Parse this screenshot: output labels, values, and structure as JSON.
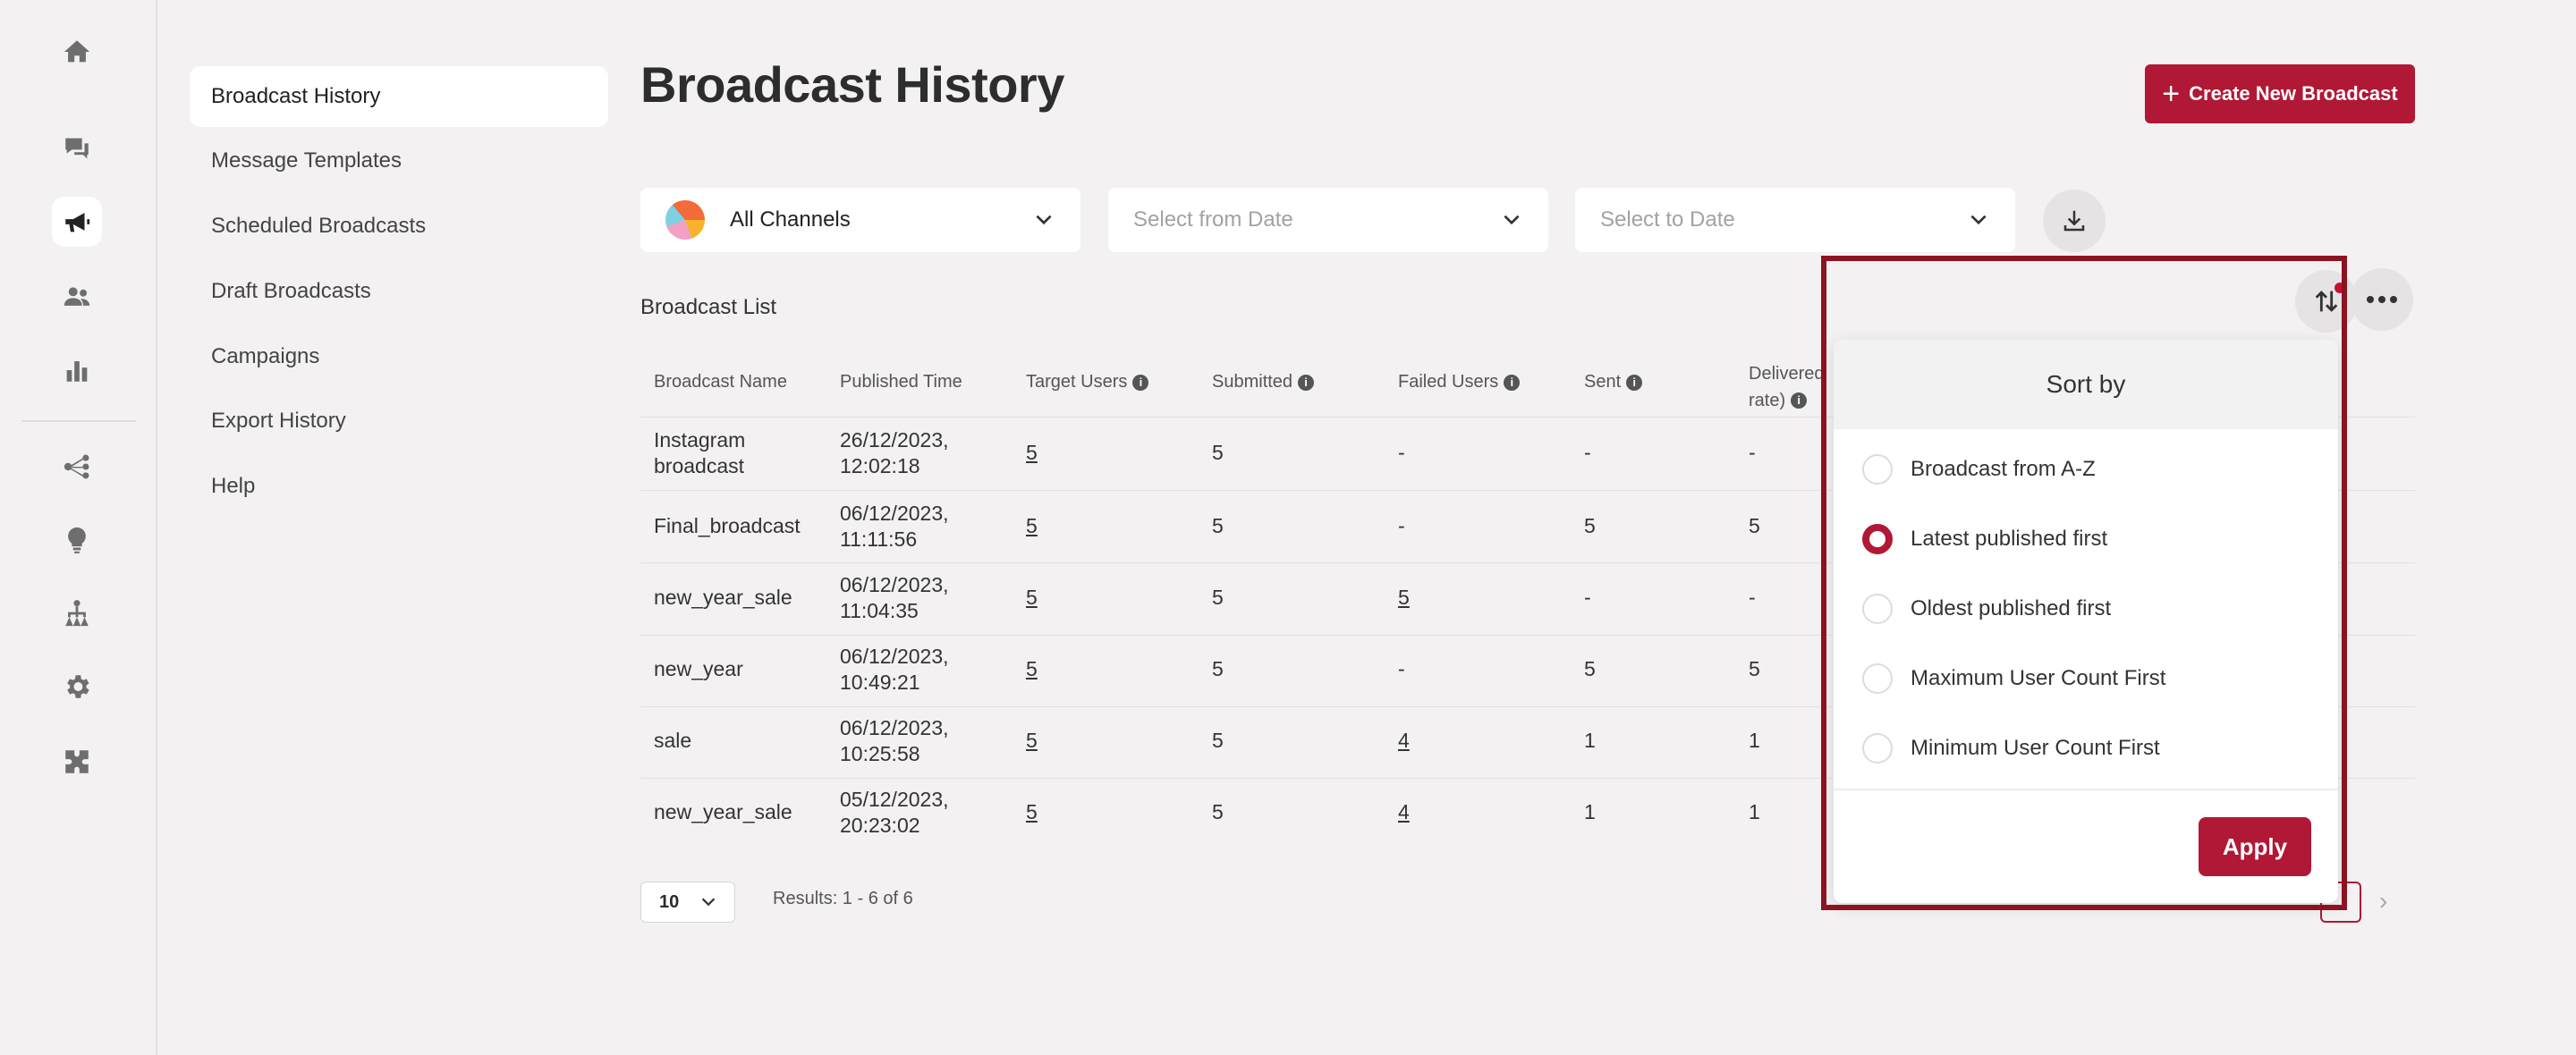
{
  "sidebar": {
    "icons": [
      "home-icon",
      "chat-icon",
      "megaphone-icon",
      "users-icon",
      "bar-chart-icon",
      "flow-icon",
      "bulb-icon",
      "hierarchy-icon",
      "gear-icon",
      "puzzle-icon"
    ],
    "nav": [
      {
        "label": "Broadcast History",
        "active": true
      },
      {
        "label": "Message Templates"
      },
      {
        "label": "Scheduled Broadcasts"
      },
      {
        "label": "Draft Broadcasts"
      },
      {
        "label": "Campaigns"
      },
      {
        "label": "Export History"
      },
      {
        "label": "Help"
      }
    ]
  },
  "header": {
    "title": "Broadcast History",
    "create_button": "Create New Broadcast"
  },
  "filters": {
    "channel": "All Channels",
    "from_date_placeholder": "Select from Date",
    "to_date_placeholder": "Select to Date"
  },
  "list": {
    "title": "Broadcast List",
    "columns": [
      "Broadcast Name",
      "Published Time",
      "Target Users",
      "Submitted",
      "Failed Users",
      "Sent",
      "Delivered",
      "rate)"
    ],
    "rows": [
      {
        "name": [
          "Instagram",
          "broadcast"
        ],
        "time": [
          "26/12/2023,",
          "12:02:18"
        ],
        "target": "5",
        "submitted": "5",
        "failed": "-",
        "sent": "-",
        "delivered": "-"
      },
      {
        "name": [
          "Final_broadcast"
        ],
        "time": [
          "06/12/2023,",
          "11:11:56"
        ],
        "target": "5",
        "submitted": "5",
        "failed": "-",
        "sent": "5",
        "delivered": "5"
      },
      {
        "name": [
          "new_year_sale"
        ],
        "time": [
          "06/12/2023,",
          "11:04:35"
        ],
        "target": "5",
        "submitted": "5",
        "failed": "5",
        "sent": "-",
        "delivered": "-"
      },
      {
        "name": [
          "new_year"
        ],
        "time": [
          "06/12/2023,",
          "10:49:21"
        ],
        "target": "5",
        "submitted": "5",
        "failed": "-",
        "sent": "5",
        "delivered": "5"
      },
      {
        "name": [
          "sale"
        ],
        "time": [
          "06/12/2023,",
          "10:25:58"
        ],
        "target": "5",
        "submitted": "5",
        "failed": "4",
        "sent": "1",
        "delivered": "1"
      },
      {
        "name": [
          "new_year_sale"
        ],
        "time": [
          "05/12/2023,",
          "20:23:02"
        ],
        "target": "5",
        "submitted": "5",
        "failed": "4",
        "sent": "1",
        "delivered": "1"
      }
    ],
    "page_size": "10",
    "results": "Results: 1 - 6 of 6"
  },
  "sort": {
    "title": "Sort by",
    "options": [
      {
        "label": "Broadcast from A-Z",
        "checked": false
      },
      {
        "label": "Latest published first",
        "checked": true
      },
      {
        "label": "Oldest published first",
        "checked": false
      },
      {
        "label": "Maximum User Count First",
        "checked": false
      },
      {
        "label": "Minimum User Count First",
        "checked": false
      }
    ],
    "apply": "Apply"
  },
  "colors": {
    "accent": "#b01835",
    "highlight": "#8c1420",
    "background": "#f3f1f2"
  }
}
